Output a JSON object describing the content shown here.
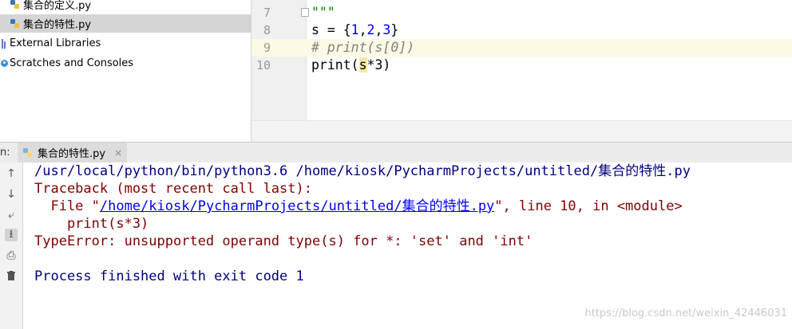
{
  "project_tree": {
    "items": [
      {
        "label": "集合的定义.py",
        "selected": false
      },
      {
        "label": "集合的特性.py",
        "selected": true
      },
      {
        "label": "External Libraries",
        "selected": false
      },
      {
        "label": "Scratches and Consoles",
        "selected": false
      }
    ]
  },
  "editor": {
    "line_numbers": [
      "7",
      "8",
      "9",
      "10"
    ],
    "line7": "\"\"\"",
    "line8": {
      "prefix": "s = {",
      "n1": "1",
      "c1": ",",
      "n2": "2",
      "c2": ",",
      "n3": "3",
      "suffix": "}"
    },
    "line9": "# print(s[0])",
    "line10": {
      "prefix": "print(",
      "cursor_char": "s",
      "suffix": "*3)"
    }
  },
  "run_panel": {
    "prefix": "n:",
    "tab_label": "集合的特性.py",
    "tab_close": "×"
  },
  "console": {
    "cmd_prefix": "/usr/local/python/bin/python3.6 /home/kiosk/PycharmProjects/untitled/",
    "cmd_file": "集合的特性.py",
    "traceback_header": "Traceback (most recent call last):",
    "file_prefix": "  File \"",
    "file_link": "/home/kiosk/PycharmProjects/untitled/集合的特性.py",
    "file_suffix": "\", line 10, in <module>",
    "code_line": "    print(s*3)",
    "error": "TypeError: unsupported operand type(s) for *: 'set' and 'int'",
    "exit": "Process finished with exit code 1"
  },
  "watermark": "https://blog.csdn.net/weixin_42446031",
  "colors": {
    "keyword_blue": "#0000ff",
    "console_blue": "#000080",
    "console_red": "#800000",
    "selected_bg": "#d5d5d5"
  }
}
